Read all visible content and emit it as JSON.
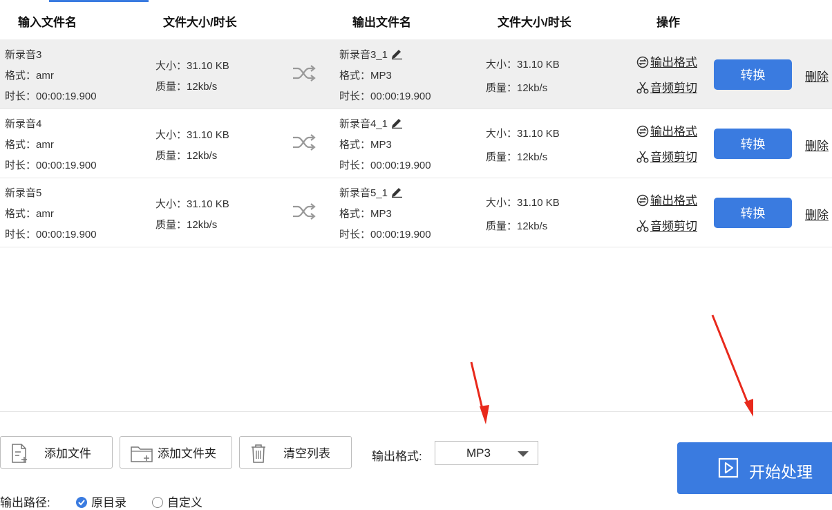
{
  "header": {
    "input_name": "输入文件名",
    "input_size": "文件大小/时长",
    "output_name": "输出文件名",
    "output_size": "文件大小/时长",
    "operation": "操作"
  },
  "rows": [
    {
      "name": "新录音3",
      "format_label": "格式：",
      "format": "amr",
      "duration_label": "时长：",
      "duration": "00:00:19.900",
      "size_label": "大小：",
      "size": "31.10 KB",
      "quality_label": "质量：",
      "quality": "12kb/s",
      "out_name": "新录音3_1",
      "out_format": "MP3",
      "out_duration": "00:00:19.900",
      "out_size": "31.10 KB",
      "out_quality": "12kb/s",
      "op_format": "输出格式",
      "op_cut": "音频剪切",
      "convert": "转换",
      "delete": "删除"
    },
    {
      "name": "新录音4",
      "format_label": "格式：",
      "format": "amr",
      "duration_label": "时长：",
      "duration": "00:00:19.900",
      "size_label": "大小：",
      "size": "31.10 KB",
      "quality_label": "质量：",
      "quality": "12kb/s",
      "out_name": "新录音4_1",
      "out_format": "MP3",
      "out_duration": "00:00:19.900",
      "out_size": "31.10 KB",
      "out_quality": "12kb/s",
      "op_format": "输出格式",
      "op_cut": "音频剪切",
      "convert": "转换",
      "delete": "删除"
    },
    {
      "name": "新录音5",
      "format_label": "格式：",
      "format": "amr",
      "duration_label": "时长：",
      "duration": "00:00:19.900",
      "size_label": "大小：",
      "size": "31.10 KB",
      "quality_label": "质量：",
      "quality": "12kb/s",
      "out_name": "新录音5_1",
      "out_format": "MP3",
      "out_duration": "00:00:19.900",
      "out_size": "31.10 KB",
      "out_quality": "12kb/s",
      "op_format": "输出格式",
      "op_cut": "音频剪切",
      "convert": "转换",
      "delete": "删除"
    }
  ],
  "toolbar": {
    "add_file": "添加文件",
    "add_folder": "添加文件夹",
    "clear_list": "清空列表",
    "output_format_label": "输出格式:",
    "output_format_value": "MP3",
    "start": "开始处理"
  },
  "output_path": {
    "label": "输出路径:",
    "option_original": "原目录",
    "option_custom": "自定义",
    "selected": "原目录"
  },
  "colors": {
    "accent": "#3a7be0",
    "annotation_arrow": "#e8291c"
  },
  "icons": [
    "shuffle-icon",
    "edit-icon",
    "format-icon",
    "scissors-icon",
    "add-file-icon",
    "add-folder-icon",
    "trash-icon",
    "play-icon"
  ]
}
